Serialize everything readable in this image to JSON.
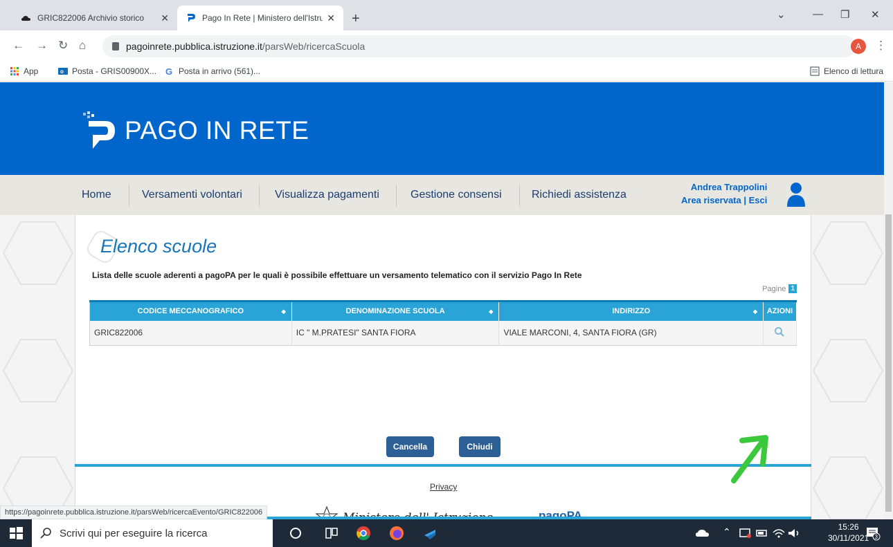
{
  "browser": {
    "tabs": [
      {
        "title": "GRIC822006 Archivio storico",
        "active": false
      },
      {
        "title": "Pago In Rete | Ministero dell'Istru",
        "active": true
      }
    ],
    "url_host": "pagoinrete.pubblica.istruzione.it",
    "url_path": "/parsWeb/ricercaScuola",
    "profile_initial": "A",
    "bookmarks": [
      {
        "label": "App",
        "icon": "apps-grid-icon"
      },
      {
        "label": "Posta - GRIS00900X...",
        "icon": "outlook-icon"
      },
      {
        "label": "Posta in arrivo (561)...",
        "icon": "google-icon"
      }
    ],
    "reading_list": "Elenco di lettura",
    "status_url": "https://pagoinrete.pubblica.istruzione.it/parsWeb/ricercaEvento/GRIC822006"
  },
  "site": {
    "brand": "PAGO IN RETE",
    "nav": [
      "Home",
      "Versamenti volontari",
      "Visualizza pagamenti",
      "Gestione consensi",
      "Richiedi assistenza"
    ],
    "user_name": "Andrea Trappolini",
    "user_links": "Area riservata | Esci",
    "accent": "#0066cc",
    "table_accent": "#2aa3d6"
  },
  "main": {
    "title": "Elenco scuole",
    "subtitle": "Lista delle scuole aderenti a pagoPA per le quali è possibile effettuare un versamento telematico con il servizio Pago In Rete",
    "pages_label": "Pagine",
    "page_number": "1",
    "table": {
      "headers": [
        "CODICE MECCANOGRAFICO",
        "DENOMINAZIONE SCUOLA",
        "INDIRIZZO",
        "AZIONI"
      ],
      "rows": [
        [
          "GRIC822006",
          "IC \" M.PRATESI\" SANTA FIORA",
          "VIALE MARCONI, 4, SANTA FIORA (GR)"
        ]
      ]
    },
    "cancel_label": "Cancella",
    "close_label": "Chiudi",
    "ministero_label": "Ministero dell' Istruzione",
    "pagopa_label": "pagoPA",
    "privacy_label": "Privacy"
  },
  "taskbar": {
    "search_placeholder": "Scrivi qui per eseguire la ricerca",
    "time": "15:26",
    "date": "30/11/2021",
    "notification_count": "3"
  }
}
